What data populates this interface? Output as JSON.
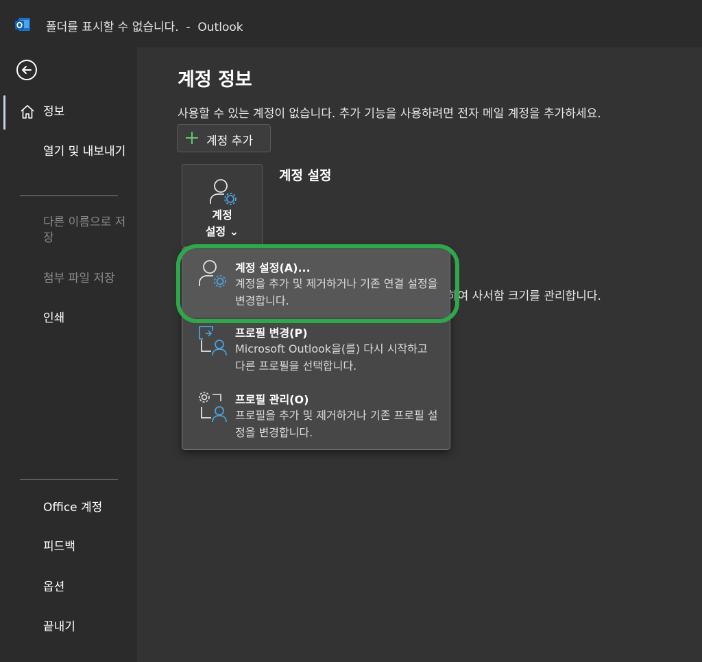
{
  "window": {
    "title": "폴더를 표시할 수 없습니다.  -  Outlook"
  },
  "sidebar": {
    "back_icon": "back-arrow-icon",
    "items": [
      {
        "label": "정보",
        "icon": "home-icon",
        "active": true
      },
      {
        "label": "열기 및 내보내기"
      },
      {
        "label": "다른 이름으로 저장",
        "disabled": true
      },
      {
        "label": "첨부 파일 저장",
        "disabled": true
      },
      {
        "label": "인쇄"
      }
    ],
    "footer_items": [
      {
        "label": "Office 계정"
      },
      {
        "label": "피드백"
      },
      {
        "label": "옵션"
      },
      {
        "label": "끝내기"
      }
    ]
  },
  "main": {
    "title": "계정 정보",
    "description": "사용할 수 있는 계정이 없습니다. 추가 기능을 사용하려면 전자 메일 계정을 추가하세요.",
    "add_account_label": "계정 추가",
    "account_settings_tile_label": "계정\n설정 ⌄",
    "account_settings_heading": "계정 설정",
    "partially_hidden_text": "하여 사서함 크기를 관리합니다."
  },
  "dropdown": {
    "items": [
      {
        "title": "계정 설정(A)...",
        "description": "계정을 추가 및 제거하거나 기존 연결 설정을 변경합니다.",
        "icon": "account-settings-icon",
        "highlighted": true
      },
      {
        "title": "프로필 변경(P)",
        "description": "Microsoft Outlook을(를) 다시 시작하고 다른 프로필을 선택합니다.",
        "icon": "change-profile-icon"
      },
      {
        "title": "프로필 관리(O)",
        "description": "프로필을 추가 및 제거하거나 기존 프로필 설정을 변경합니다.",
        "icon": "manage-profiles-icon"
      }
    ]
  },
  "colors": {
    "accent": "#4aa3df",
    "highlight_ring": "#2ea84a",
    "add_plus": "#5fc779"
  }
}
